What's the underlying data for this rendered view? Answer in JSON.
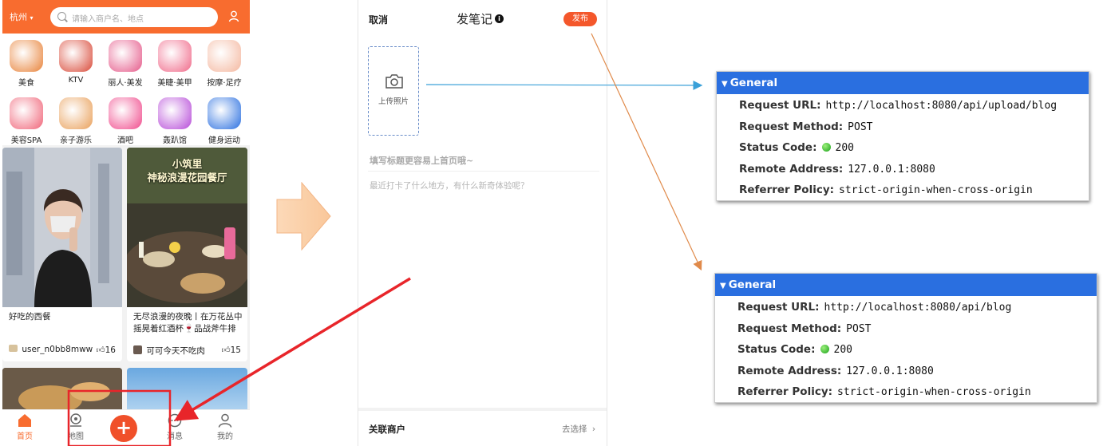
{
  "home": {
    "city": "杭州",
    "search_placeholder": "请输入商户名、地点",
    "categories": [
      {
        "label": "美食",
        "icon": "roast-chicken-icon",
        "color": "#e8833a"
      },
      {
        "label": "KTV",
        "icon": "microphone-icon",
        "color": "#d94b3a"
      },
      {
        "label": "丽人·美发",
        "icon": "hair-salon-icon",
        "color": "#e55a8a"
      },
      {
        "label": "美睫·美甲",
        "icon": "manicure-icon",
        "color": "#f06a8a"
      },
      {
        "label": "按摩·足疗",
        "icon": "foot-massage-icon",
        "color": "#f4b8a0"
      },
      {
        "label": "美容SPA",
        "icon": "face-mask-icon",
        "color": "#f06478"
      },
      {
        "label": "亲子游乐",
        "icon": "parent-child-icon",
        "color": "#e9a05a"
      },
      {
        "label": "酒吧",
        "icon": "cocktail-icon",
        "color": "#f04a8c"
      },
      {
        "label": "轰趴馆",
        "icon": "party-mask-icon",
        "color": "#b64ad8"
      },
      {
        "label": "健身运动",
        "icon": "dumbbell-icon",
        "color": "#2a6fe0"
      }
    ],
    "blogs": [
      {
        "title": "好吃的西餐",
        "author": "user_n0bb8mww",
        "likes": "16"
      },
      {
        "overlay_title": "小筑里\n神秘浪漫花园餐厅",
        "title": "无尽浪漫的夜晚丨在万花丛中摇晃着红酒杯🍷品战斧牛排",
        "author": "可可今天不吃肉",
        "likes": "15"
      }
    ],
    "tabs": [
      {
        "label": "首页",
        "icon": "home-icon"
      },
      {
        "label": "地图",
        "icon": "map-pin-icon"
      },
      {
        "label": "",
        "icon": "plus-icon"
      },
      {
        "label": "消息",
        "icon": "message-icon"
      },
      {
        "label": "我的",
        "icon": "user-icon"
      }
    ],
    "plus": "+"
  },
  "post": {
    "cancel": "取消",
    "title": "发笔记",
    "info": "i",
    "publish": "发布",
    "upload_label": "上传照片",
    "title_placeholder": "填写标题更容易上首页哦~",
    "content_placeholder": "最近打卡了什么地方，有什么新奇体验呢？",
    "shop_label": "关联商户",
    "shop_select": "去选择"
  },
  "requests": [
    {
      "header": "General",
      "rows": [
        {
          "key": "Request URL:",
          "value": "http://localhost:8080/api/upload/blog"
        },
        {
          "key": "Request Method:",
          "value": "POST"
        },
        {
          "key": "Status Code:",
          "value": "200"
        },
        {
          "key": "Remote Address:",
          "value": "127.0.0.1:8080"
        },
        {
          "key": "Referrer Policy:",
          "value": "strict-origin-when-cross-origin"
        }
      ]
    },
    {
      "header": "General",
      "rows": [
        {
          "key": "Request URL:",
          "value": "http://localhost:8080/api/blog"
        },
        {
          "key": "Request Method:",
          "value": "POST"
        },
        {
          "key": "Status Code:",
          "value": "200"
        },
        {
          "key": "Remote Address:",
          "value": "127.0.0.1:8080"
        },
        {
          "key": "Referrer Policy:",
          "value": "strict-origin-when-cross-origin"
        }
      ]
    }
  ],
  "colors": {
    "brand": "#f86c2f",
    "devtools_header": "#2a6fe0",
    "annotation_red": "#e8252a",
    "annotation_blue": "#3aa0d8",
    "annotation_orange": "#e08a4a",
    "big_arrow": "#fbd3b0"
  }
}
